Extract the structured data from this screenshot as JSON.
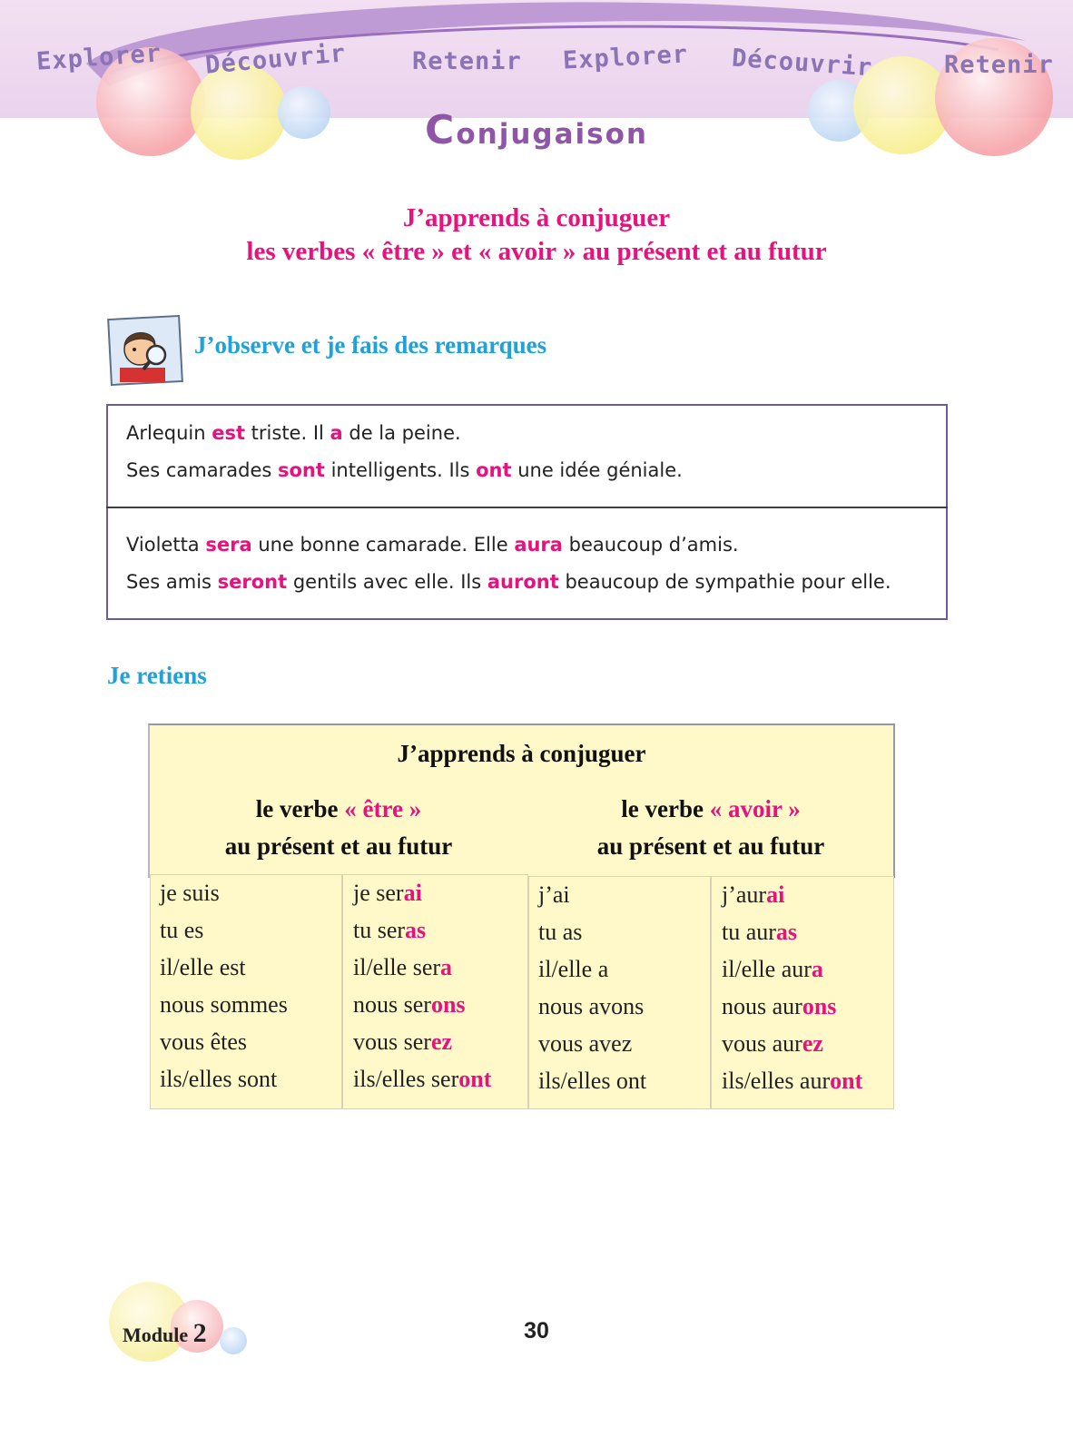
{
  "banner": {
    "words": [
      "Explorer",
      "Découvrir",
      "Retenir",
      "Explorer",
      "Découvrir",
      "Retenir"
    ]
  },
  "section_title": {
    "first_letter": "C",
    "rest": "onjugaison"
  },
  "lesson_title": {
    "line1": "J’apprends à conjuguer",
    "line2": "les verbes « être » et « avoir » au présent et au futur"
  },
  "observe": {
    "heading": "J’observe et je fais des remarques",
    "present_lines": [
      [
        {
          "t": "Arlequin "
        },
        {
          "t": "est",
          "hl": true
        },
        {
          "t": " triste. Il "
        },
        {
          "t": "a",
          "hl": true
        },
        {
          "t": " de la peine."
        }
      ],
      [
        {
          "t": "Ses camarades "
        },
        {
          "t": "sont",
          "hl": true
        },
        {
          "t": " intelligents. Ils "
        },
        {
          "t": "ont",
          "hl": true
        },
        {
          "t": " une idée géniale."
        }
      ]
    ],
    "future_lines": [
      [
        {
          "t": "Violetta "
        },
        {
          "t": "sera",
          "hl": true
        },
        {
          "t": " une bonne camarade. Elle "
        },
        {
          "t": "aura",
          "hl": true
        },
        {
          "t": " beaucoup d’amis."
        }
      ],
      [
        {
          "t": "Ses amis "
        },
        {
          "t": "seront",
          "hl": true
        },
        {
          "t": " gentils avec elle. Ils "
        },
        {
          "t": "auront",
          "hl": true
        },
        {
          "t": " beaucoup de sympathie pour elle."
        }
      ]
    ]
  },
  "retiens": {
    "heading": "Je retiens",
    "panel_title": "J’apprends à conjuguer",
    "etre": {
      "label_before": "le verbe ",
      "verb": "« être »",
      "subtitle": "au présent et au futur"
    },
    "avoir": {
      "label_before": "le verbe ",
      "verb": "« avoir »",
      "subtitle": "au présent et au futur"
    },
    "columns": [
      [
        [
          "je suis",
          ""
        ],
        [
          "tu es",
          ""
        ],
        [
          "il/elle est",
          ""
        ],
        [
          "nous sommes",
          ""
        ],
        [
          "vous êtes",
          ""
        ],
        [
          "ils/elles sont",
          ""
        ]
      ],
      [
        [
          "je ser",
          "ai"
        ],
        [
          "tu ser",
          "as"
        ],
        [
          "il/elle ser",
          "a"
        ],
        [
          "nous ser",
          "ons"
        ],
        [
          "vous ser",
          "ez"
        ],
        [
          "ils/elles ser",
          "ont"
        ]
      ],
      [
        [
          "j’ai",
          ""
        ],
        [
          "tu as",
          ""
        ],
        [
          "il/elle a",
          ""
        ],
        [
          "nous avons",
          ""
        ],
        [
          "vous avez",
          ""
        ],
        [
          "ils/elles ont",
          ""
        ]
      ],
      [
        [
          "j’aur",
          "ai"
        ],
        [
          "tu aur",
          "as"
        ],
        [
          "il/elle aur",
          "a"
        ],
        [
          "nous aur",
          "ons"
        ],
        [
          "vous aur",
          "ez"
        ],
        [
          "ils/elles aur",
          "ont"
        ]
      ]
    ]
  },
  "footer": {
    "module_word": "Module",
    "module_number": "2",
    "page_number": "30"
  },
  "colors": {
    "accent_pink": "#e6127e",
    "heading_blue": "#1fa1d9",
    "title_purple": "#8f55a6",
    "panel_yellow": "#fff8c9"
  }
}
